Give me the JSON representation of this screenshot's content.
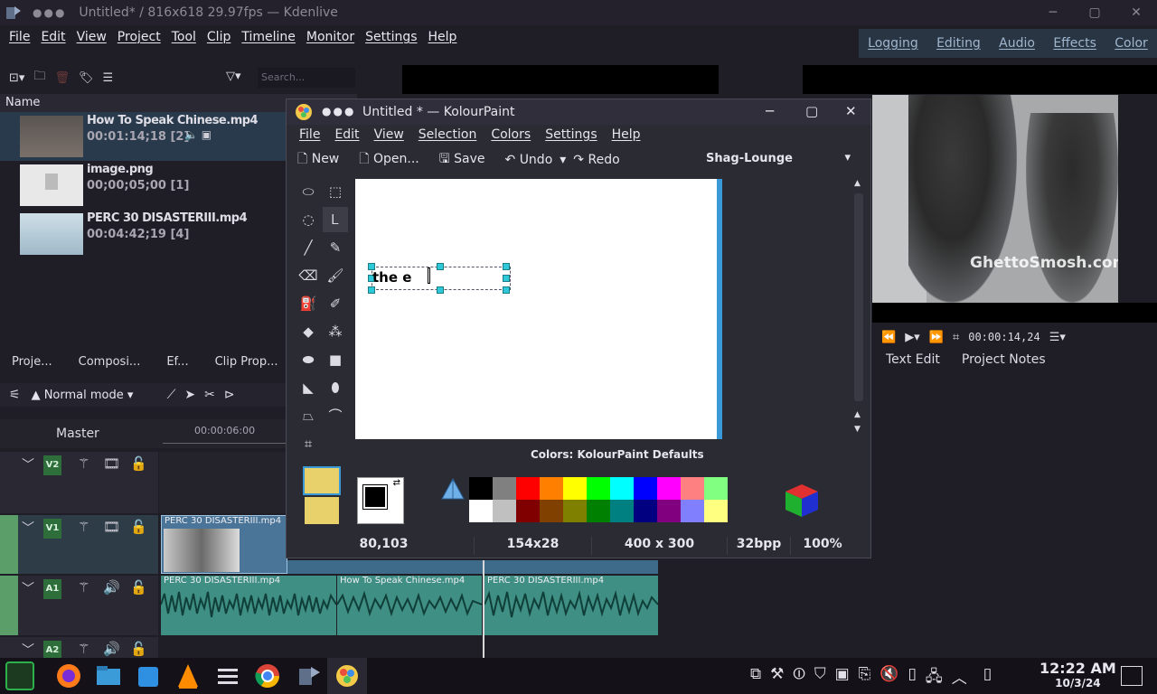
{
  "kdenlive": {
    "title": "Untitled* / 816x618 29.97fps — Kdenlive",
    "menu": [
      "File",
      "Edit",
      "View",
      "Project",
      "Tool",
      "Clip",
      "Timeline",
      "Monitor",
      "Settings",
      "Help"
    ],
    "layouts": [
      "Logging",
      "Editing",
      "Audio",
      "Effects",
      "Color"
    ],
    "bin": {
      "search_placeholder": "Search...",
      "column_name": "Name",
      "clips": [
        {
          "name": "How To Speak Chinese.mp4",
          "duration": "00:01:14;18 [2]"
        },
        {
          "name": "image.png",
          "duration": "00;00;05;00 [1]"
        },
        {
          "name": "PERC 30 DISASTERIII.mp4",
          "duration": "00:04:42;19 [4]"
        }
      ],
      "tabs": [
        "Proje...",
        "Composi...",
        "Ef...",
        "Clip Prop..."
      ]
    },
    "timeline": {
      "mode": "Normal mode",
      "master_label": "Master",
      "ruler_timecode": "00:00:06:00",
      "tracks": [
        "V2",
        "V1",
        "A1",
        "A2"
      ],
      "clips": {
        "v1_clip": "PERC 30 DISASTERIII.mp4",
        "a1_clip1": "PERC 30 DISASTERIII.mp4",
        "a1_clip2": "How To Speak Chinese.mp4",
        "a1_clip3": "PERC 30 DISASTERIII.mp4"
      }
    },
    "monitor": {
      "watermark": "GhettoSmosh.com",
      "timecode": "00:00:14,24",
      "tabs": [
        "Text Edit",
        "Project Notes"
      ]
    }
  },
  "kolourpaint": {
    "title": "Untitled * — KolourPaint",
    "menu": [
      "File",
      "Edit",
      "View",
      "Selection",
      "Colors",
      "Settings",
      "Help"
    ],
    "toolbar": {
      "new": "New",
      "open": "Open...",
      "save": "Save",
      "undo": "Undo",
      "redo": "Redo",
      "theme": "Shag-Lounge"
    },
    "canvas_text": "the e",
    "colors_label": "Colors: KolourPaint Defaults",
    "palette": [
      "#000000",
      "#808080",
      "#ff0000",
      "#ff8000",
      "#ffff00",
      "#00ff00",
      "#00ffff",
      "#0000ff",
      "#ff00ff",
      "#ff8080",
      "#80ff80",
      "#ffffff",
      "#c0c0c0",
      "#800000",
      "#804000",
      "#808000",
      "#008000",
      "#008080",
      "#000080",
      "#800080",
      "#8080ff",
      "#ffff80"
    ],
    "status": {
      "cursor": "80,103",
      "selection": "154x28",
      "image_size": "400 x 300",
      "depth": "32bpp",
      "zoom": "100%"
    }
  },
  "taskbar": {
    "time": "12:22 AM",
    "date": "10/3/24"
  }
}
